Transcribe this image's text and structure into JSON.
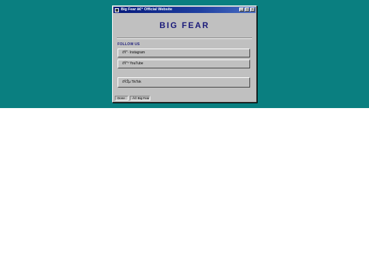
{
  "window": {
    "title": "Big Fear â€“ Official Website",
    "buttons": [
      "_",
      "□",
      "×"
    ]
  },
  "site": {
    "title": "BIG FEAR",
    "follow_label": "FOLLOW US",
    "links": [
      {
        "label": "ðŸ“· Instagram",
        "icon": "instagram-icon"
      },
      {
        "label": "ðŸ“º YouTube",
        "icon": "youtube-icon"
      },
      {
        "label": "ðŸŽµ TikTok",
        "icon": "tiktok-icon"
      }
    ]
  },
  "status": {
    "state": "Done",
    "copyright": "Â© Big Fear"
  },
  "colors": {
    "desktop": "#0a7f80",
    "window": "#c0c0c0",
    "titlebar": "#05187a",
    "heading": "#1a1a7a"
  }
}
